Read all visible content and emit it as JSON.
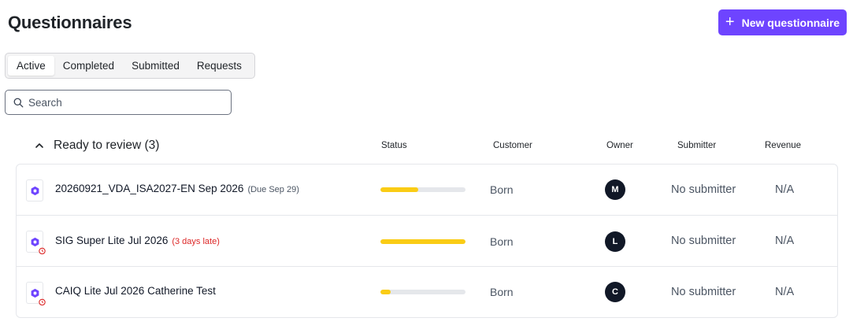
{
  "header": {
    "title": "Questionnaires",
    "new_button_label": "New questionnaire"
  },
  "tabs": [
    {
      "label": "Active",
      "active": true
    },
    {
      "label": "Completed",
      "active": false
    },
    {
      "label": "Submitted",
      "active": false
    },
    {
      "label": "Requests",
      "active": false
    }
  ],
  "search": {
    "placeholder": "Search",
    "value": ""
  },
  "group": {
    "label": "Ready to review (3)",
    "expanded": true
  },
  "columns": {
    "status": "Status",
    "customer": "Customer",
    "owner": "Owner",
    "submitter": "Submitter",
    "revenue": "Revenue"
  },
  "rows": [
    {
      "name": "20260921_VDA_ISA2027-EN Sep 2026",
      "due_note": "(Due Sep 29)",
      "late_note": "",
      "progress_percent": 44,
      "progress_color": "#facc15",
      "customer": "Born",
      "owner_initial": "M",
      "submitter": "No submitter",
      "revenue": "N/A",
      "alarm": false
    },
    {
      "name": "SIG Super Lite Jul 2026",
      "due_note": "",
      "late_note": "(3 days late)",
      "progress_percent": 100,
      "progress_color": "#facc15",
      "customer": "Born",
      "owner_initial": "L",
      "submitter": "No submitter",
      "revenue": "N/A",
      "alarm": true
    },
    {
      "name": "CAIQ Lite Jul 2026 Catherine Test",
      "due_note": "",
      "late_note": "",
      "progress_percent": 12,
      "progress_color": "#facc15",
      "customer": "Born",
      "owner_initial": "C",
      "submitter": "No submitter",
      "revenue": "N/A",
      "alarm": true
    }
  ],
  "colors": {
    "accent": "#6e44ff",
    "progress_fill": "#facc15",
    "late_text": "#dc2626",
    "avatar_bg": "#111827"
  },
  "icons": {
    "new_button": "plus-icon",
    "search": "search-icon",
    "group_toggle": "chevron-up-icon",
    "row_doc": "questionnaire-doc-icon",
    "row_alarm": "alarm-clock-icon"
  }
}
